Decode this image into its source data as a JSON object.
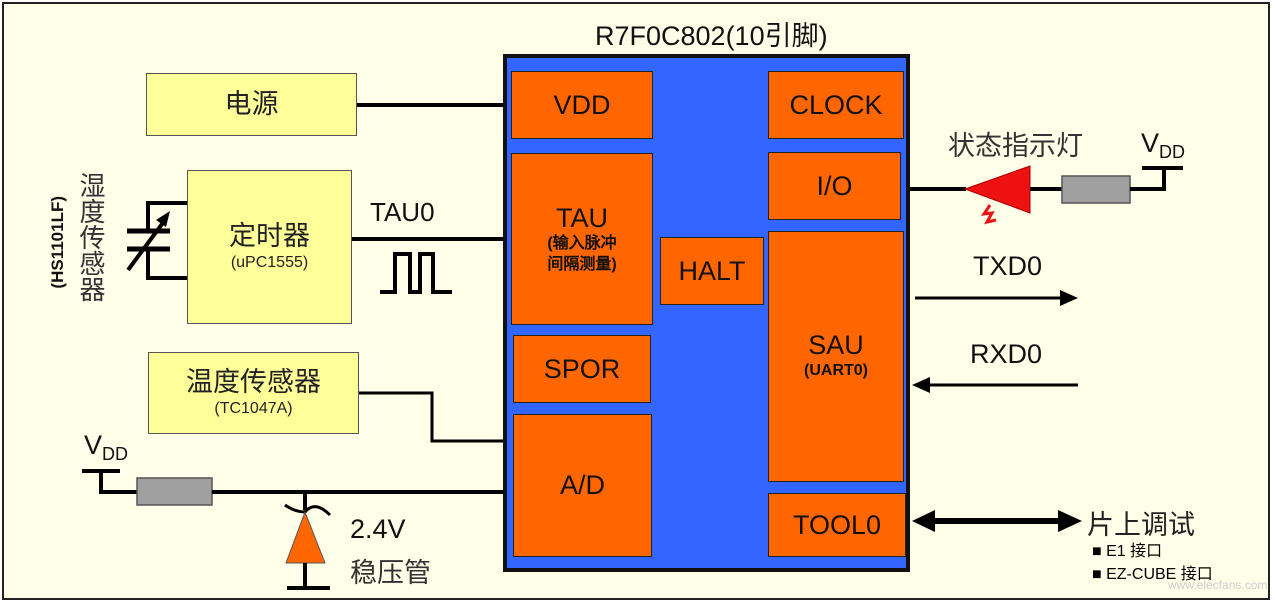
{
  "title": "R7F0C802(10引脚)",
  "chip_blocks": {
    "vdd": "VDD",
    "clock": "CLOCK",
    "io": "I/O",
    "tau": "TAU",
    "tau_note_1": "(输入脉冲",
    "tau_note_2": "间隔测量)",
    "halt": "HALT",
    "spor": "SPOR",
    "sau": "SAU",
    "sau_note": "(UART0)",
    "ad": "A/D",
    "tool0": "TOOL0"
  },
  "external": {
    "power": "电源",
    "timer": "定时器",
    "timer_part": "(uPC1555)",
    "humidity_sensor": "湿度传感器",
    "humidity_part": "(HS1101LF)",
    "temp_sensor": "温度传感器",
    "temp_part": "(TC1047A)",
    "tau0_signal": "TAU0",
    "vdd_left": "V",
    "vdd_left_sub": "DD",
    "zener_voltage": "2.4V",
    "zener_label": "稳压管",
    "status_led": "状态指示灯",
    "vdd_right": "V",
    "vdd_right_sub": "DD",
    "txd": "TXD0",
    "rxd": "RXD0",
    "debug_title": "片上调试",
    "debug_items": [
      "E1 接口",
      "EZ-CUBE 接口"
    ]
  },
  "watermark": "www.elecfans.com",
  "colors": {
    "background": "#fffee8",
    "chip": "#3366ff",
    "block": "#ff6600",
    "external_box": "#ffff99",
    "led": "#ee1111",
    "resistor": "#a0a0a0"
  }
}
